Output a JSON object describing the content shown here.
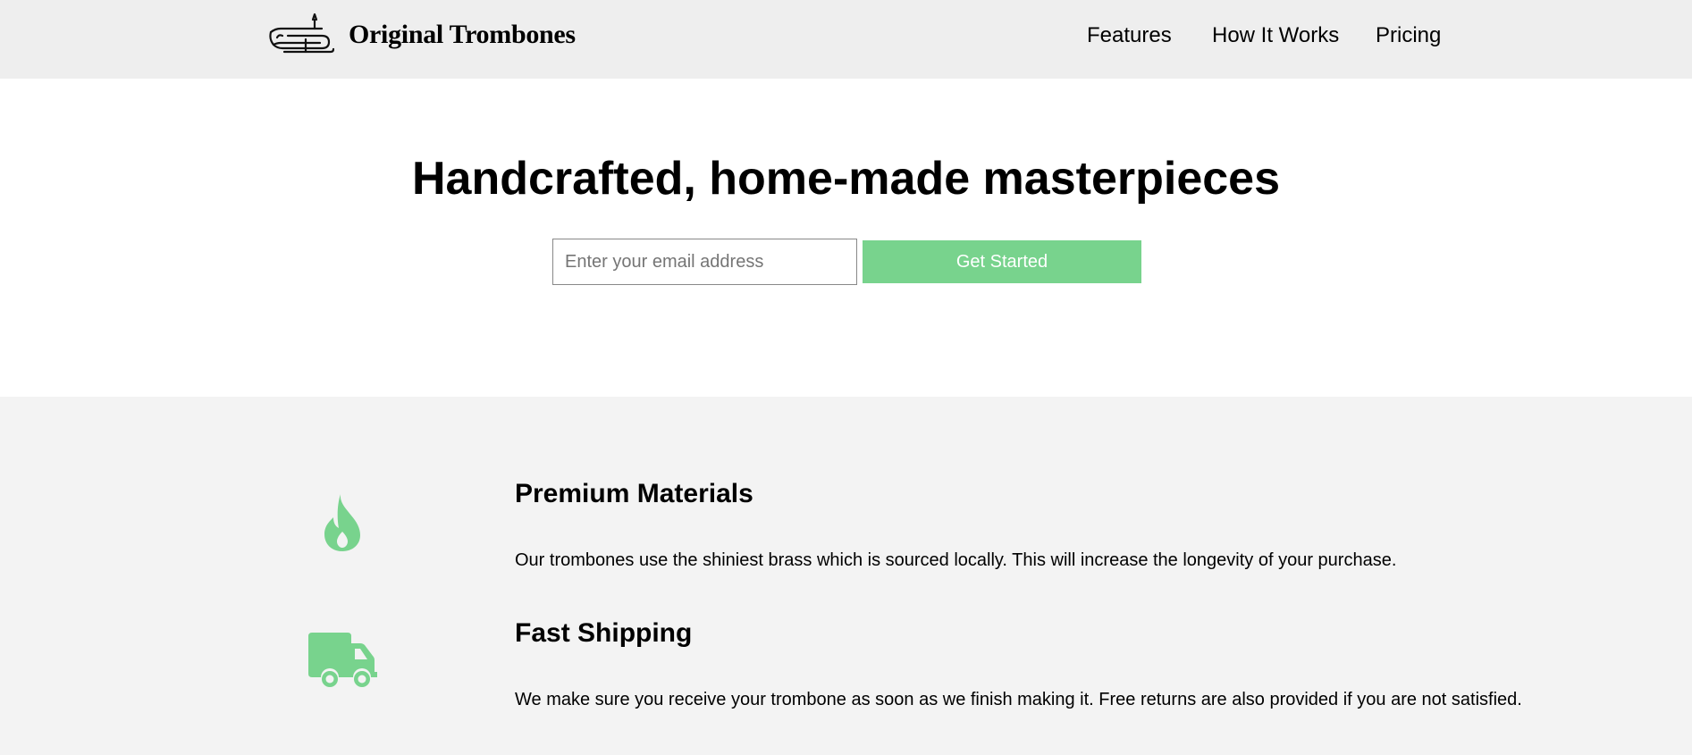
{
  "brand": {
    "name": "Original Trombones",
    "logo_icon": "trombone-icon"
  },
  "nav": {
    "links": [
      "Features",
      "How It Works",
      "Pricing"
    ]
  },
  "hero": {
    "heading": "Handcrafted, home-made masterpieces",
    "email_placeholder": "Enter your email address",
    "email_value": "",
    "cta_label": "Get Started"
  },
  "features": [
    {
      "icon": "fire-icon",
      "title": "Premium Materials",
      "description": "Our trombones use the shiniest brass which is sourced locally. This will increase the longevity of your purchase."
    },
    {
      "icon": "truck-icon",
      "title": "Fast Shipping",
      "description": "We make sure you receive your trombone as soon as we finish making it. Free returns are also provided if you are not satisfied."
    }
  ],
  "colors": {
    "accent": "#78d38d",
    "header_bg": "#eeeeee",
    "features_bg": "#f3f3f3"
  }
}
